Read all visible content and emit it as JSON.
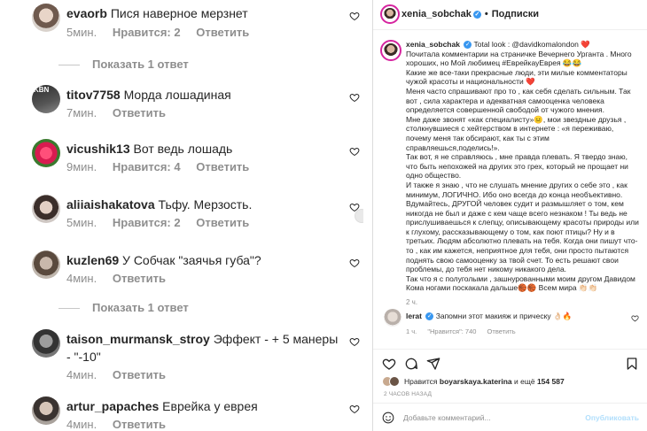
{
  "comments_panel": {
    "comments": [
      {
        "user": "evaorb",
        "text": "Пися наверное мерзнет",
        "time": "5мин.",
        "likes": "Нравится: 2",
        "reply": "Ответить"
      },
      {
        "user": "titov7758",
        "text": "Морда лошадиная",
        "time": "7мин.",
        "likes": "",
        "reply": "Ответить"
      },
      {
        "user": "vicushik13",
        "text": "Вот ведь лошадь",
        "time": "9мин.",
        "likes": "Нравится: 4",
        "reply": "Ответить"
      },
      {
        "user": "aliiaishakatova",
        "text": "Тьфу.  Мерзость.",
        "time": "5мин.",
        "likes": "Нравится: 2",
        "reply": "Ответить"
      },
      {
        "user": "kuzlen69",
        "text": "У Собчак \"заячья губа\"?",
        "time": "4мин.",
        "likes": "",
        "reply": "Ответить"
      },
      {
        "user": "taison_murmansk_stroy",
        "text": "Эффект - + 5 манеры - \"-10\"",
        "time": "4мин.",
        "likes": "",
        "reply": "Ответить"
      },
      {
        "user": "artur_papaches",
        "text": "Еврейка у еврея",
        "time": "4мин.",
        "likes": "",
        "reply": "Ответить"
      }
    ],
    "show_replies_1": "Показать 1 ответ",
    "show_replies_2": "Показать 1 ответ",
    "avatar_badge": "KBN"
  },
  "post": {
    "header_user": "xenia_sobchak",
    "header_follow": "Подписки",
    "caption_user": "xenia_sobchak",
    "caption_lines": [
      "Total look : @davidkomalondon ❤️",
      "Почитала комментарии на страничке Вечернего Урганта . Много хороших, но Мой любимец #ЕврейкауЕврея 😂😂",
      "Какие же все-таки прекрасные люди, эти милые комментаторы чужой красоты и национальности ❤️",
      "Меня часто спрашивают про то , как себя сделать сильным. Так вот , сила характера и адекватная самооценка человека определяется совершенной свободой от чужого мнения.",
      "Мне даже звонят «как специалисту»😐, мои звездные друзья , столкнувшиеся с хейтерством в интернете : «я переживаю, почему меня так обсирают, как ты с этим справляешься,поделись!».",
      "Так вот, я не справляюсь , мне правда плевать. Я твердо знаю, что быть непохожей на других это грех, который не прощает ни одно общество.",
      "И также я знаю , что не слушать мнение других о себе это , как минимум, ЛОГИЧНО. Ибо оно всегда до конца необъективно.",
      "Вдумайтесь, ДРУГОЙ человек судит и размышляет о том, кем никогда не был и даже с кем чаще всего незнаком ! Ты ведь не прислушиваешься к слепцу, описывающему красоты природы или к глухому, рассказывающему о том, как поют птицы? Ну и в третьих. Людям абсолютно плевать на тебя. Когда они пишут что-то , как им кажется, неприятное для тебя, они просто пытаются поднять свою самооценку за твой счет. То есть решают свои проблемы, до тебя нет никому никакого дела.",
      "Так что я с полуголыми , зашнурованными моим другом Давидом Кома ногами поскакала дальше🏀🏀 Всем мира 👏🏻👏🏻"
    ],
    "caption_time": "2 ч.",
    "top_comment": {
      "user": "lerat",
      "text": "Запомни этот макияж и прическу 👌🏻🔥",
      "time": "1 ч.",
      "likes": "\"Нравится\": 740",
      "reply": "Ответить"
    },
    "likes_text_prefix": "Нравится",
    "likes_user": "boyarskaya.katerina",
    "likes_text_mid": "и ещё",
    "likes_count": "154 587",
    "posted_ago": "2 ЧАСОВ НАЗАД",
    "add_comment_placeholder": "Добавьте комментарий...",
    "publish": "Опубликовать"
  },
  "colors": {
    "link": "#00376b",
    "muted": "#8e8e8e",
    "publish_disabled": "#b2dffc",
    "verified": "#3897f0"
  }
}
